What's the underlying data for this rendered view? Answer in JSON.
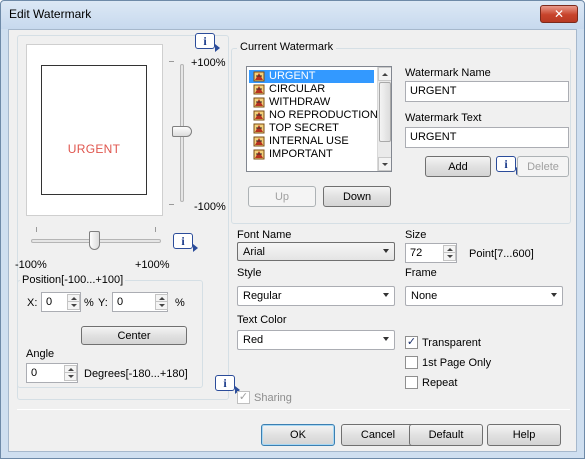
{
  "window": {
    "title": "Edit Watermark",
    "close_glyph": "✕"
  },
  "preview": {
    "watermark_text": "URGENT",
    "vertical": {
      "top_label": "+100%",
      "bottom_label": "-100%",
      "value_percent": 0
    },
    "horizontal": {
      "left_label": "-100%",
      "right_label": "+100%",
      "value_percent": 0
    }
  },
  "position": {
    "label": "Position[-100...+100]",
    "x_label": "X:",
    "x_value": "0",
    "x_unit": "%",
    "y_label": "Y:",
    "y_value": "0",
    "y_unit": "%",
    "center_label": "Center"
  },
  "angle": {
    "label": "Angle",
    "value": "0",
    "unit": "Degrees[-180...+180]"
  },
  "current_watermark": {
    "group_label": "Current Watermark",
    "items": [
      {
        "label": "URGENT",
        "selected": true
      },
      {
        "label": "CIRCULAR"
      },
      {
        "label": "WITHDRAW"
      },
      {
        "label": "NO REPRODUCTION"
      },
      {
        "label": "TOP SECRET"
      },
      {
        "label": "INTERNAL USE"
      },
      {
        "label": "IMPORTANT"
      }
    ],
    "up_label": "Up",
    "down_label": "Down"
  },
  "watermark_name": {
    "label": "Watermark Name",
    "value": "URGENT"
  },
  "watermark_text": {
    "label": "Watermark Text",
    "value": "URGENT"
  },
  "add_label": "Add",
  "delete_label": "Delete",
  "font_name": {
    "label": "Font Name",
    "value": "Arial"
  },
  "size": {
    "label": "Size",
    "value": "72",
    "unit": "Point[7...600]"
  },
  "style": {
    "label": "Style",
    "value": "Regular"
  },
  "frame": {
    "label": "Frame",
    "value": "None"
  },
  "text_color": {
    "label": "Text Color",
    "value": "Red"
  },
  "checks": {
    "transparent": {
      "label": "Transparent",
      "checked": true
    },
    "first_page_only": {
      "label": "1st Page Only",
      "checked": false
    },
    "repeat": {
      "label": "Repeat",
      "checked": false
    },
    "sharing": {
      "label": "Sharing",
      "checked": true,
      "disabled": true
    }
  },
  "footer": {
    "ok": "OK",
    "cancel": "Cancel",
    "default": "Default",
    "help": "Help"
  },
  "icons": {
    "info": "info-icon",
    "watermark": "watermark-icon",
    "check_mark": "✓",
    "info_glyph": "i"
  },
  "colors": {
    "selection": "#3399ff",
    "preview_text": "#e0564e",
    "close": "#c7432b"
  }
}
